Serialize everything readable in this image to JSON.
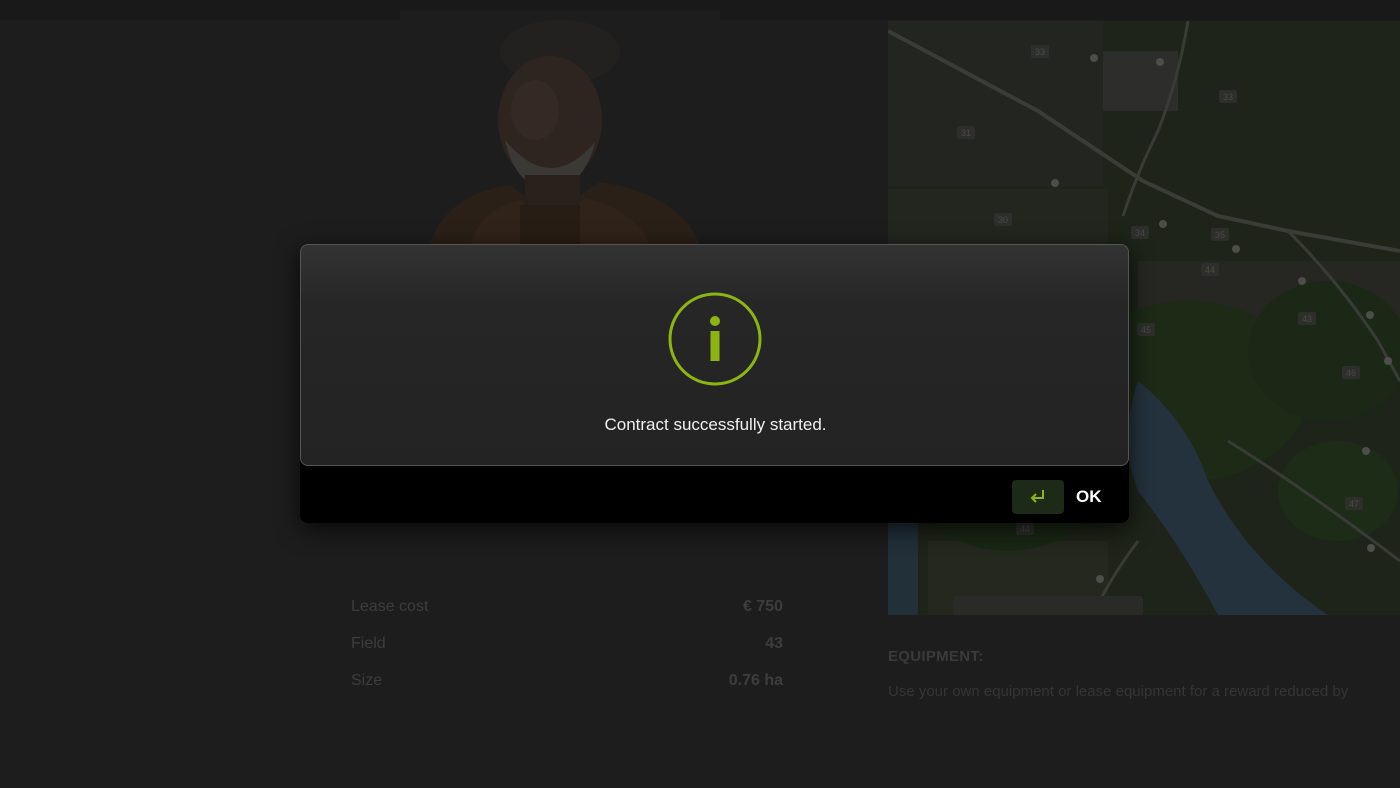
{
  "dialog": {
    "message": "Contract successfully started.",
    "ok_label": "OK",
    "accent_color": "#8db512",
    "icon": "info-icon",
    "key_icon": "enter-key-icon"
  },
  "details": [
    {
      "label": "Lease cost",
      "value": "€ 750"
    },
    {
      "label": "Field",
      "value": "43"
    },
    {
      "label": "Size",
      "value": "0.76 ha"
    }
  ],
  "equipment": {
    "title": "EQUIPMENT:",
    "text": "Use your own equipment or lease equipment for a reward reduced by"
  },
  "map": {
    "field_numbers": [
      "33",
      "33",
      "31",
      "30",
      "34",
      "35",
      "44",
      "45",
      "43",
      "46",
      "47",
      "44"
    ]
  }
}
